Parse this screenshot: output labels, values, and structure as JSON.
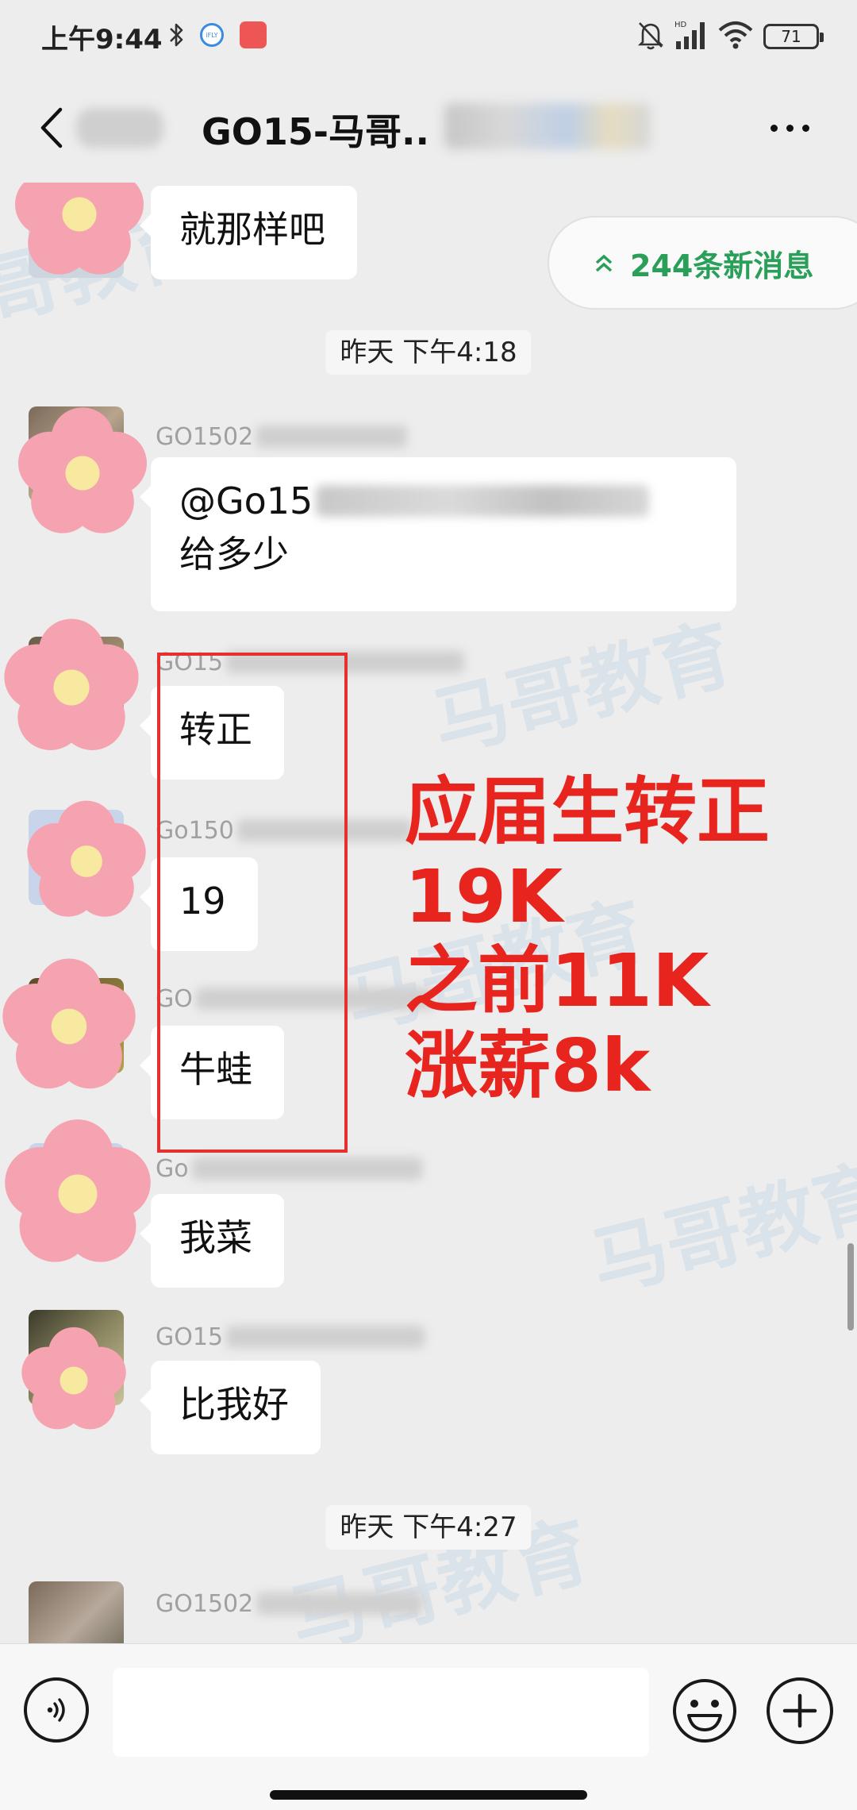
{
  "status_bar": {
    "time": "上午9:44",
    "battery": "71",
    "icons": [
      "bluetooth-icon",
      "ifly-app-icon",
      "red-app-icon",
      "bell-muted-icon",
      "signal-icon",
      "wifi-icon",
      "battery-icon"
    ]
  },
  "nav": {
    "title": "GO15-马哥..",
    "back_icon": "chevron-left-icon",
    "more_icon": "more-dots-icon"
  },
  "watermark_text": "马哥教育",
  "new_messages": {
    "label": "244条新消息",
    "icon": "double-chevron-up-icon",
    "color": "#2a9f5a"
  },
  "messages": [
    {
      "sender": "",
      "text": "就那样吧"
    },
    {
      "sender": "GO1502",
      "lines": [
        "@Go15",
        "给多少"
      ]
    },
    {
      "sender": "GO15",
      "text": "转正"
    },
    {
      "sender": "Go150",
      "text": "19"
    },
    {
      "sender": "GO",
      "text": "牛蛙"
    },
    {
      "sender": "Go",
      "text": "我菜"
    },
    {
      "sender": "GO15",
      "text": "比我好"
    },
    {
      "sender": "GO1502",
      "text": ""
    }
  ],
  "timestamps": [
    "昨天 下午4:18",
    "昨天 下午4:27"
  ],
  "annotation": {
    "lines": [
      "应届生转正",
      "19K",
      "之前11K",
      "涨薪8k"
    ],
    "color": "#e8241e"
  },
  "input_bar": {
    "placeholder": "",
    "voice_icon": "voice-icon",
    "emoji_icon": "emoji-icon",
    "plus_icon": "plus-icon"
  },
  "colors": {
    "background": "#ededed",
    "bubble": "#ffffff",
    "accent_green": "#2a9f5a",
    "annotation_red": "#e53030"
  }
}
